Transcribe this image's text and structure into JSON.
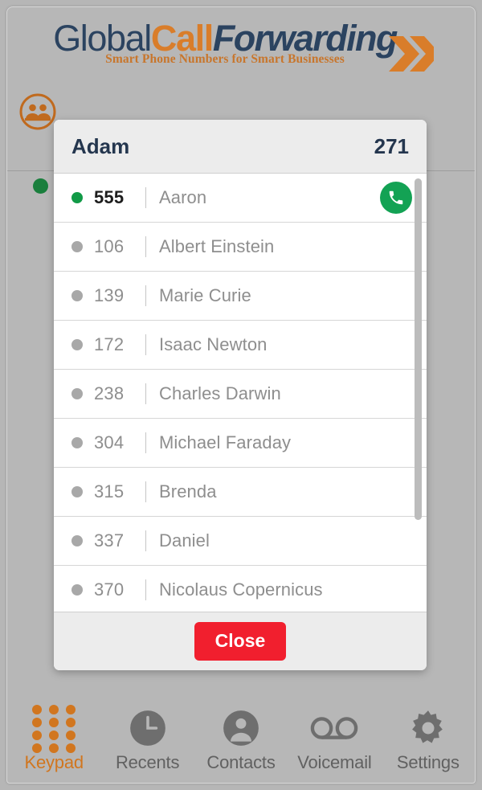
{
  "brand": {
    "word1": "Global",
    "word2": "Call",
    "word3": "Forwarding",
    "tagline": "Smart Phone Numbers for Smart Businesses",
    "colors": {
      "navy": "#2b4360",
      "orange": "#d97d2a",
      "tagline_orange": "#c8762c"
    }
  },
  "page": {
    "group_icon": "contacts-group-icon",
    "presence_dot_color": "#1a7f3d"
  },
  "modal": {
    "title": "Adam",
    "count": "271",
    "close_label": "Close",
    "close_color": "#f11f2e",
    "call_button_color": "#13a254",
    "online_dot_color": "#119a47",
    "offline_dot_color": "#a8a8a8",
    "separator": "|",
    "contacts": [
      {
        "ext": "555",
        "name": "Aaron",
        "online": true,
        "has_call_button": true
      },
      {
        "ext": "106",
        "name": "Albert Einstein",
        "online": false,
        "has_call_button": false
      },
      {
        "ext": "139",
        "name": "Marie Curie",
        "online": false,
        "has_call_button": false
      },
      {
        "ext": "172",
        "name": "Isaac Newton",
        "online": false,
        "has_call_button": false
      },
      {
        "ext": "238",
        "name": "Charles Darwin",
        "online": false,
        "has_call_button": false
      },
      {
        "ext": "304",
        "name": "Michael Faraday",
        "online": false,
        "has_call_button": false
      },
      {
        "ext": "315",
        "name": "Brenda",
        "online": false,
        "has_call_button": false
      },
      {
        "ext": "337",
        "name": "Daniel",
        "online": false,
        "has_call_button": false
      },
      {
        "ext": "370",
        "name": "Nicolaus Copernicus",
        "online": false,
        "has_call_button": false
      }
    ]
  },
  "bottom_nav": {
    "active_color": "#d1761f",
    "inactive_color": "#616161",
    "items": [
      {
        "label": "Keypad",
        "icon": "keypad-icon",
        "active": true
      },
      {
        "label": "Recents",
        "icon": "clock-icon",
        "active": false
      },
      {
        "label": "Contacts",
        "icon": "person-icon",
        "active": false
      },
      {
        "label": "Voicemail",
        "icon": "voicemail-icon",
        "active": false
      },
      {
        "label": "Settings",
        "icon": "gear-icon",
        "active": false
      }
    ]
  }
}
